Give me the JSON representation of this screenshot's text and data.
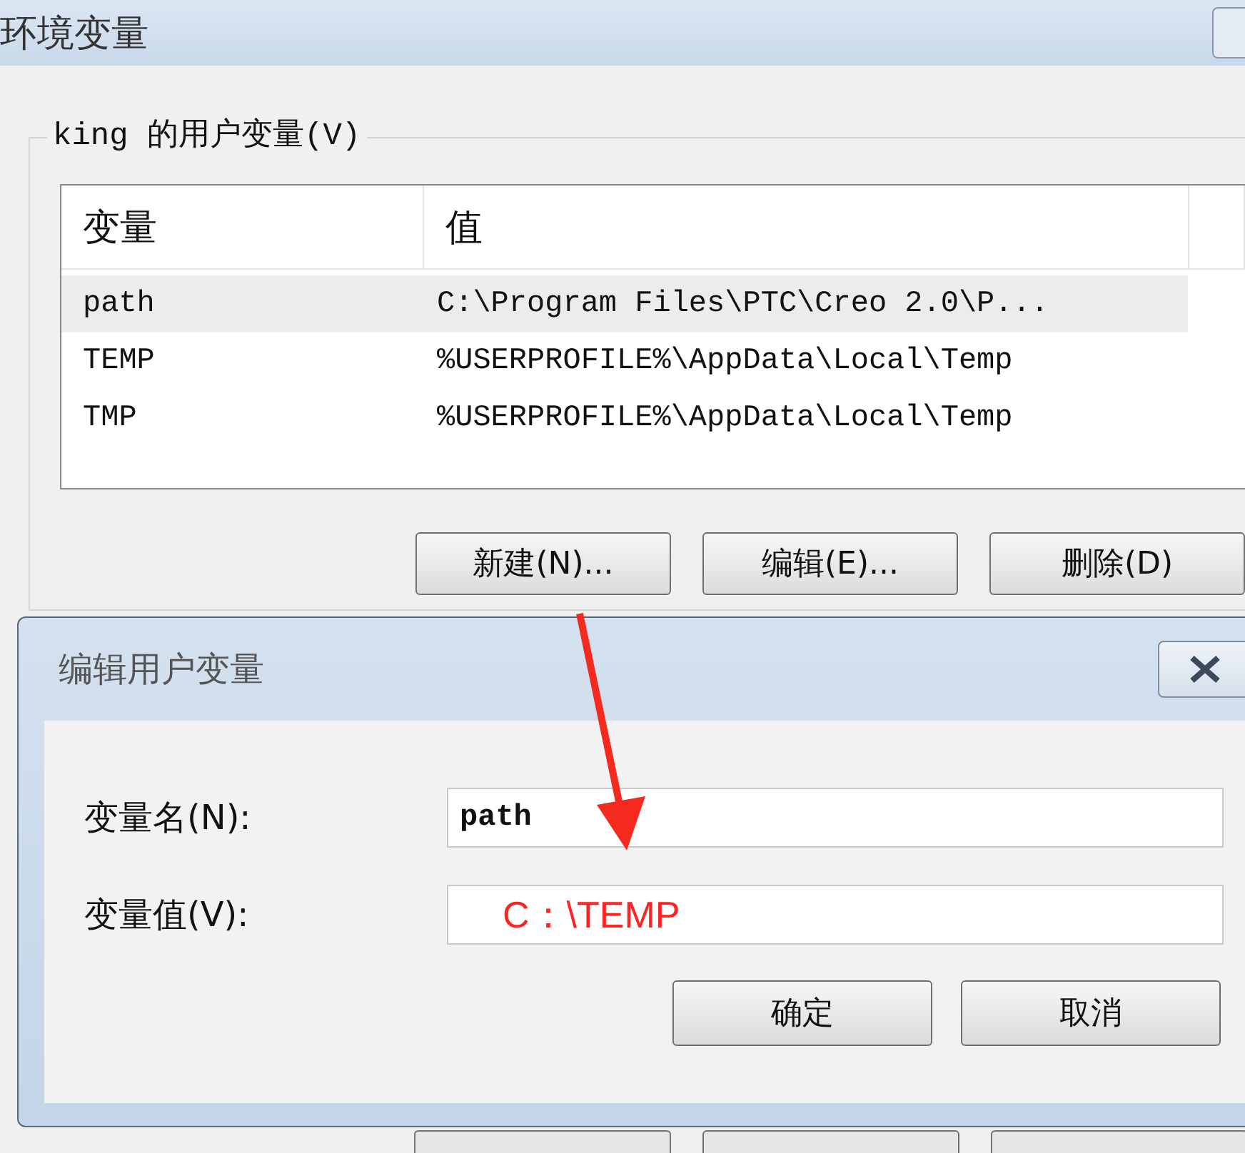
{
  "window": {
    "title": "环境变量"
  },
  "user_variables": {
    "label": "king 的用户变量(V)",
    "columns": [
      "变量",
      "值"
    ],
    "rows": [
      {
        "name": "path",
        "value": "C:\\Program Files\\PTC\\Creo 2.0\\P...",
        "selected": true
      },
      {
        "name": "TEMP",
        "value": "%USERPROFILE%\\AppData\\Local\\Temp",
        "selected": false
      },
      {
        "name": "TMP",
        "value": "%USERPROFILE%\\AppData\\Local\\Temp",
        "selected": false
      }
    ],
    "buttons": [
      "新建(N)...",
      "编辑(E)...",
      "删除(D)"
    ]
  },
  "dialog": {
    "title": "编辑用户变量",
    "fields": [
      {
        "label": "变量名(N):",
        "value": "path"
      },
      {
        "label": "变量值(V):"
      }
    ],
    "buttons": [
      "确定",
      "取消"
    ]
  },
  "annotations": [
    {
      "kind": "arrow"
    },
    {
      "kind": "text",
      "text": "C：\\TEMP"
    }
  ]
}
